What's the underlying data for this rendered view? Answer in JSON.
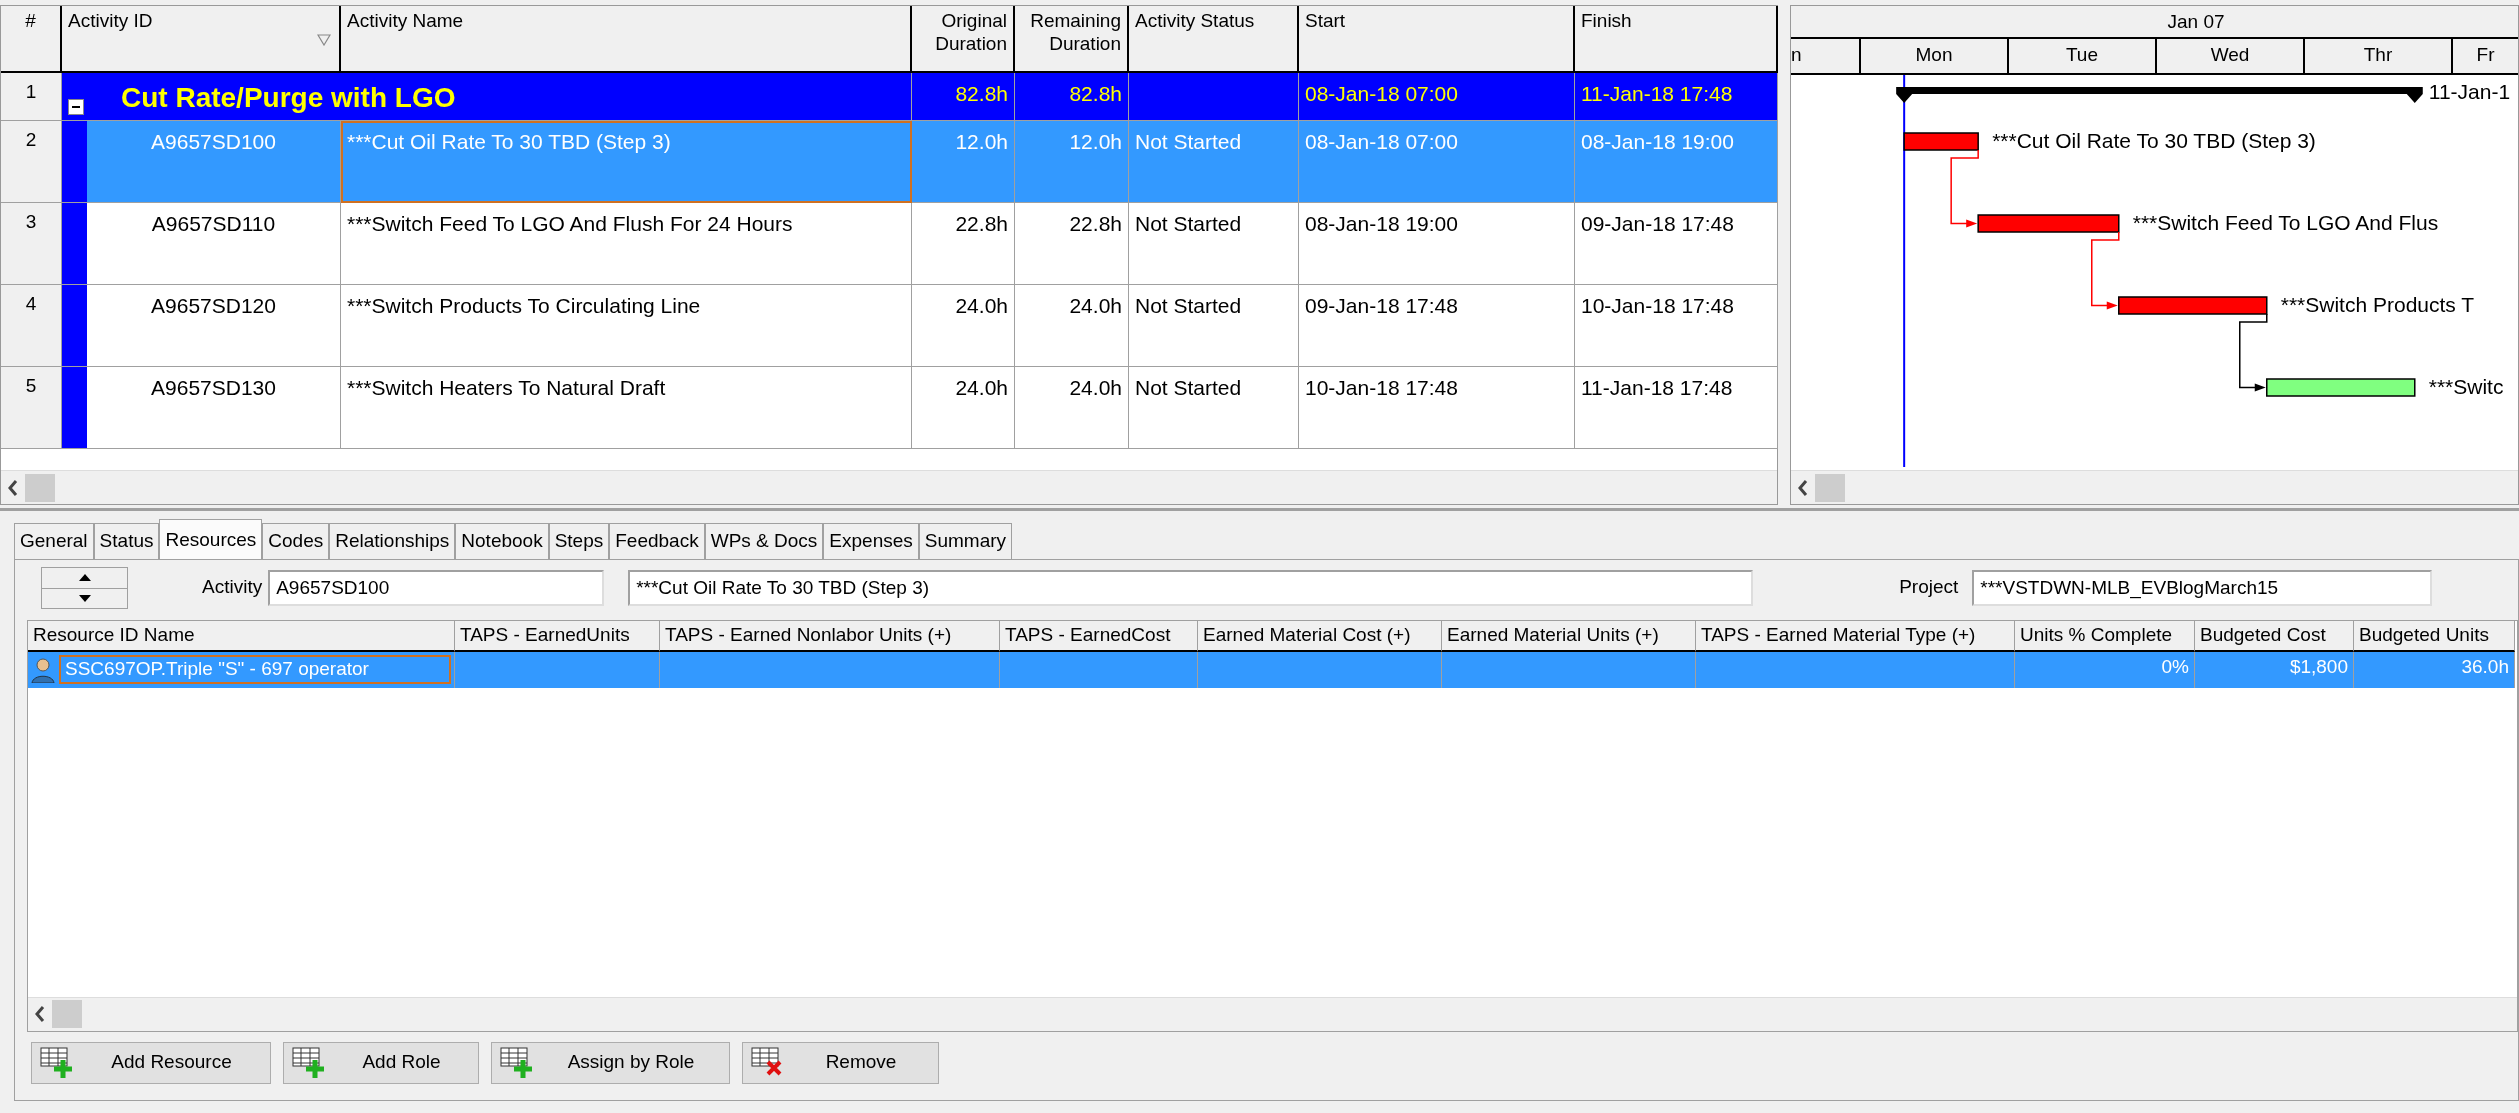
{
  "activity_table": {
    "columns": [
      {
        "label": "#",
        "sorted": false
      },
      {
        "label": "Activity ID",
        "sorted": true
      },
      {
        "label": "Activity Name",
        "sorted": false
      },
      {
        "label": "Original Duration",
        "sorted": false
      },
      {
        "label": "Remaining Duration",
        "sorted": false
      },
      {
        "label": "Activity Status",
        "sorted": false
      },
      {
        "label": "Start",
        "sorted": false
      },
      {
        "label": "Finish",
        "sorted": false
      }
    ],
    "wbs": {
      "number": "1",
      "name": "Cut Rate/Purge with LGO",
      "original_duration": "82.8h",
      "remaining_duration": "82.8h",
      "start": "08-Jan-18 07:00",
      "finish": "11-Jan-18 17:48",
      "expanded": true,
      "children": [
        {
          "number": "2",
          "id": "A9657SD100",
          "name": "***Cut Oil Rate To 30 TBD (Step 3)",
          "original_duration": "12.0h",
          "remaining_duration": "12.0h",
          "status": "Not Started",
          "start": "08-Jan-18 07:00",
          "finish": "08-Jan-18 19:00",
          "selected": true
        },
        {
          "number": "3",
          "id": "A9657SD110",
          "name": "***Switch Feed To LGO And Flush For 24 Hours",
          "original_duration": "22.8h",
          "remaining_duration": "22.8h",
          "status": "Not Started",
          "start": "08-Jan-18 19:00",
          "finish": "09-Jan-18 17:48",
          "selected": false
        },
        {
          "number": "4",
          "id": "A9657SD120",
          "name": "***Switch Products To Circulating Line",
          "original_duration": "24.0h",
          "remaining_duration": "24.0h",
          "status": "Not Started",
          "start": "09-Jan-18 17:48",
          "finish": "10-Jan-18 17:48",
          "selected": false
        },
        {
          "number": "5",
          "id": "A9657SD130",
          "name": "***Switch Heaters To Natural Draft",
          "original_duration": "24.0h",
          "remaining_duration": "24.0h",
          "status": "Not Started",
          "start": "10-Jan-18 17:48",
          "finish": "11-Jan-18 17:48",
          "selected": false
        }
      ]
    }
  },
  "gantt": {
    "month": "Jan 07",
    "days": [
      "n",
      "Mon",
      "Tue",
      "Wed",
      "Thr",
      "Fr"
    ],
    "summary_label": "11-Jan-1",
    "bars": [
      {
        "label": "***Cut Oil Rate To 30 TBD (Step 3)",
        "color": "#ff0000"
      },
      {
        "label": "***Switch Feed To LGO And Flus",
        "color": "#ff0000"
      },
      {
        "label": "***Switch Products T",
        "color": "#ff0000"
      },
      {
        "label": "***Switc",
        "color": "#80ff80"
      }
    ]
  },
  "details": {
    "tabs": [
      {
        "label": "General",
        "selected": false
      },
      {
        "label": "Status",
        "selected": false
      },
      {
        "label": "Resources",
        "selected": true
      },
      {
        "label": "Codes",
        "selected": false
      },
      {
        "label": "Relationships",
        "selected": false
      },
      {
        "label": "Notebook",
        "selected": false
      },
      {
        "label": "Steps",
        "selected": false
      },
      {
        "label": "Feedback",
        "selected": false
      },
      {
        "label": "WPs & Docs",
        "selected": false
      },
      {
        "label": "Expenses",
        "selected": false
      },
      {
        "label": "Summary",
        "selected": false
      }
    ],
    "activity_label": "Activity",
    "activity_id": "A9657SD100",
    "activity_name": "***Cut Oil Rate To 30 TBD (Step 3)",
    "project_label": "Project",
    "project": "***VSTDWN-MLB_EVBlogMarch15",
    "resources": {
      "columns": [
        "Resource ID Name",
        "TAPS - EarnedUnits",
        "TAPS - Earned Nonlabor Units (+)",
        "TAPS - EarnedCost",
        "Earned Material Cost (+)",
        "Earned Material Units (+)",
        "TAPS - Earned Material Type (+)",
        "Units % Complete",
        "Budgeted Cost",
        "Budgeted Units"
      ],
      "rows": [
        {
          "selected": true,
          "cells": [
            "SSC697OP.Triple \"S\" - 697 operator",
            null,
            null,
            null,
            null,
            null,
            null,
            "0%",
            "$1,800",
            "36.0h"
          ]
        }
      ]
    },
    "buttons": [
      {
        "label": "Add Resource",
        "kind": "add"
      },
      {
        "label": "Add Role",
        "kind": "add"
      },
      {
        "label": "Assign by Role",
        "kind": "add"
      },
      {
        "label": "Remove",
        "kind": "remove"
      }
    ]
  }
}
